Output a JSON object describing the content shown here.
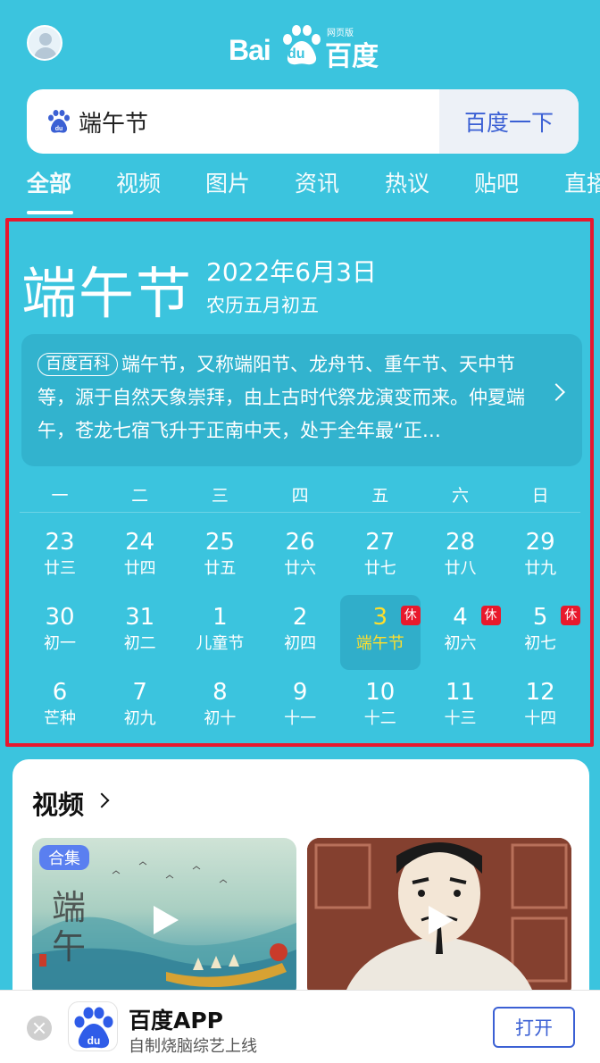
{
  "header": {
    "logo_text": "Bai",
    "logo_du": "du",
    "logo_cn": "百度",
    "logo_sub": "网页版"
  },
  "search": {
    "value": "端午节",
    "button_label": "百度一下"
  },
  "tabs": [
    {
      "label": "全部"
    },
    {
      "label": "视频"
    },
    {
      "label": "图片"
    },
    {
      "label": "资讯"
    },
    {
      "label": "热议"
    },
    {
      "label": "贴吧"
    },
    {
      "label": "直播"
    }
  ],
  "festival": {
    "title": "端午节",
    "date": "2022年6月3日",
    "lunar": "农历五月初五",
    "baike_tag": "百度百科",
    "baike_text": "端午节，又称端阳节、龙舟节、重午节、天中节等，源于自然天象崇拜，由上古时代祭龙演变而来。仲夏端午，苍龙七宿飞升于正南中天，处于全年最“正…"
  },
  "calendar": {
    "weekdays": [
      "一",
      "二",
      "三",
      "四",
      "五",
      "六",
      "日"
    ],
    "rest_label": "休",
    "days": [
      {
        "num": "23",
        "lunar": "廿三"
      },
      {
        "num": "24",
        "lunar": "廿四"
      },
      {
        "num": "25",
        "lunar": "廿五"
      },
      {
        "num": "26",
        "lunar": "廿六"
      },
      {
        "num": "27",
        "lunar": "廿七"
      },
      {
        "num": "28",
        "lunar": "廿八"
      },
      {
        "num": "29",
        "lunar": "廿九"
      },
      {
        "num": "30",
        "lunar": "初一"
      },
      {
        "num": "31",
        "lunar": "初二"
      },
      {
        "num": "1",
        "lunar": "儿童节"
      },
      {
        "num": "2",
        "lunar": "初四"
      },
      {
        "num": "3",
        "lunar": "端午节"
      },
      {
        "num": "4",
        "lunar": "初六"
      },
      {
        "num": "5",
        "lunar": "初七"
      },
      {
        "num": "6",
        "lunar": "芒种"
      },
      {
        "num": "7",
        "lunar": "初九"
      },
      {
        "num": "8",
        "lunar": "初十"
      },
      {
        "num": "9",
        "lunar": "十一"
      },
      {
        "num": "10",
        "lunar": "十二"
      },
      {
        "num": "11",
        "lunar": "十三"
      },
      {
        "num": "12",
        "lunar": "十四"
      }
    ]
  },
  "video": {
    "section_title": "视频",
    "badge": "合集",
    "thumb1_chars": "端午"
  },
  "app_bar": {
    "name": "百度APP",
    "desc": "自制烧脑综艺上线",
    "open_label": "打开"
  },
  "colors": {
    "background": "#3bc4de",
    "accent_blue": "#3b60d4",
    "highlight_red": "#e8182e",
    "selected_yellow": "#ffde2c",
    "rest_red": "#e8192c"
  }
}
